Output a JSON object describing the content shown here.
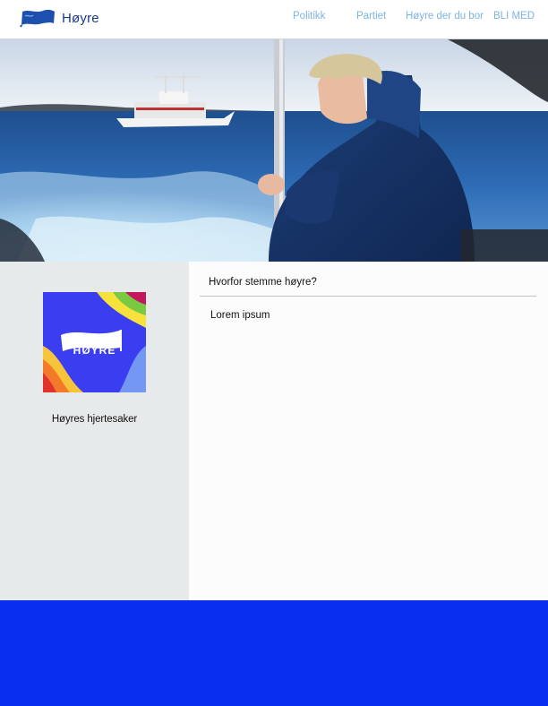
{
  "header": {
    "brand_name": "Høyre",
    "nav": [
      {
        "label": "Politikk"
      },
      {
        "label": "Partiet"
      },
      {
        "label": "Høyre der du bor"
      },
      {
        "label": "BLI MED"
      }
    ]
  },
  "hero": {
    "image": "hero-photo-woman-on-boat"
  },
  "sidebar": {
    "logo_text": "HØYRE",
    "caption": "Høyres hjertesaker"
  },
  "main": {
    "heading": "Hvorfor stemme høyre?",
    "body": "Lorem ipsum"
  },
  "colors": {
    "nav_link": "#7db2e4",
    "brand_blue": "#1b3a8c",
    "footer_blue": "#0a2eed",
    "sidebar_bg": "#e6eaea"
  }
}
